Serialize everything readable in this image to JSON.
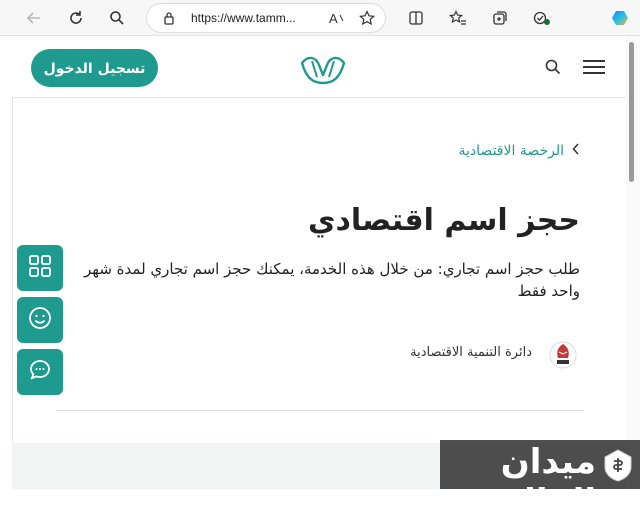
{
  "browser": {
    "url_display": "https://www.tamm...",
    "icons": [
      "back-arrow-icon",
      "refresh-icon",
      "search-icon",
      "lock-icon",
      "read-aloud-icon",
      "favorite-star-icon",
      "split-screen-icon",
      "favorites-icon",
      "collections-icon",
      "extensions-icon",
      "copilot-icon"
    ]
  },
  "header": {
    "login_label": "تسجيل الدخول",
    "icons": [
      "tamm-logo-icon",
      "search-icon",
      "menu-icon"
    ]
  },
  "breadcrumb": {
    "label": "الرخصة الاقتصادية"
  },
  "page": {
    "title": "حجز اسم اقتصادي",
    "description": "طلب حجز اسم تجاري: من خلال هذه الخدمة، يمكنك حجز اسم تجاري لمدة شهر واحد فقط"
  },
  "department": {
    "name": "دائرة التنمية الاقتصادية"
  },
  "side_buttons": [
    "apps-grid-icon",
    "feedback-smile-icon",
    "chat-icon"
  ],
  "watermark": {
    "text": "ميدان المال"
  },
  "colors": {
    "brand": "#1e9a8e",
    "text": "#222222"
  }
}
